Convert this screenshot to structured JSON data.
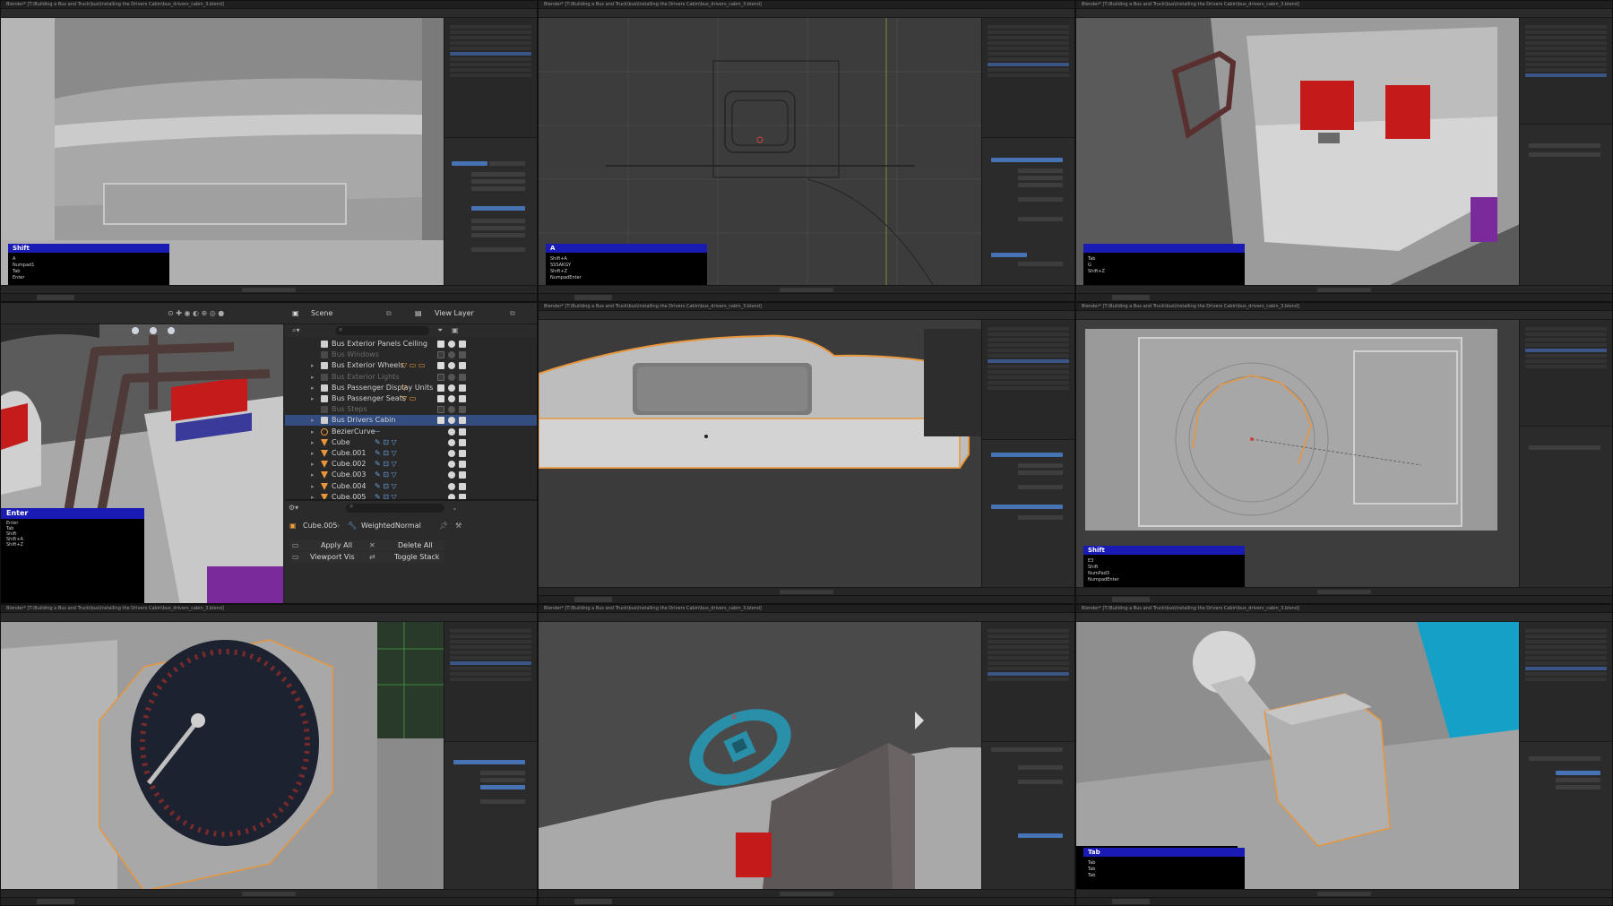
{
  "panels_small": {
    "window_title": "Blender* [T:\\Building a Bus and Truck\\bus\\Installing the Drivers Cabin\\bus_drivers_cabin_3.blend]",
    "p1_keys": {
      "head": "Shift",
      "lines": [
        "A",
        "Numpad1",
        "Tab",
        "Enter"
      ]
    },
    "p2_keys": {
      "head": "A",
      "lines": [
        "Shift+A",
        "SSSAKGY",
        "Shift+Z",
        "NumpadEnter"
      ]
    },
    "p3_keys": {
      "head": "",
      "lines": [
        "Tab",
        "G",
        "Shift+Z"
      ]
    },
    "p6_keys": {
      "head": "Shift",
      "lines": [
        "E3",
        "Shift",
        "NumPad3",
        "NumpadEnter"
      ]
    },
    "p9_keys": {
      "head": "Tab",
      "lines": [
        "Tab",
        "Tab",
        "Tab"
      ]
    }
  },
  "main_panel": {
    "scene_label": "Scene",
    "view_layer_label": "View Layer",
    "outliner_rows": [
      {
        "name": "Bus Exterior Panels Ceiling",
        "dim": false,
        "sel": false,
        "mods": "",
        "icon": "collection",
        "arrow": ""
      },
      {
        "name": "Bus Windows",
        "dim": true,
        "sel": false,
        "mods": "",
        "icon": "collection",
        "arrow": ""
      },
      {
        "name": "Bus Exterior Wheels",
        "dim": false,
        "sel": false,
        "mods": "▽ ▭ ▭",
        "icon": "collection",
        "arrow": "▸"
      },
      {
        "name": "Bus Exterior Lights",
        "dim": true,
        "sel": false,
        "mods": "",
        "icon": "collection",
        "arrow": "▸"
      },
      {
        "name": "Bus Passenger Display Units",
        "dim": false,
        "sel": false,
        "mods": "▽",
        "icon": "collection",
        "arrow": "▸"
      },
      {
        "name": "Bus Passenger Seats",
        "dim": false,
        "sel": false,
        "mods": "▽ ▭",
        "icon": "collection",
        "arrow": "▸"
      },
      {
        "name": "Bus Steps",
        "dim": true,
        "sel": false,
        "mods": "",
        "icon": "collection",
        "arrow": ""
      },
      {
        "name": "Bus Drivers Cabin",
        "dim": false,
        "sel": true,
        "mods": "",
        "icon": "collection",
        "arrow": "▸"
      },
      {
        "name": "BezierCurve",
        "dim": false,
        "sel": false,
        "mods": "~",
        "icon": "curve",
        "arrow": "▸"
      },
      {
        "name": "Cube",
        "dim": false,
        "sel": false,
        "mods": "✎ ⊡ ▽",
        "icon": "mesh",
        "arrow": "▸"
      },
      {
        "name": "Cube.001",
        "dim": false,
        "sel": false,
        "mods": "✎ ⊡ ▽",
        "icon": "mesh",
        "arrow": "▸"
      },
      {
        "name": "Cube.002",
        "dim": false,
        "sel": false,
        "mods": "✎ ⊡ ▽",
        "icon": "mesh",
        "arrow": "▸"
      },
      {
        "name": "Cube.003",
        "dim": false,
        "sel": false,
        "mods": "✎ ⊡ ▽",
        "icon": "mesh",
        "arrow": "▸"
      },
      {
        "name": "Cube.004",
        "dim": false,
        "sel": false,
        "mods": "✎ ⊡ ▽",
        "icon": "mesh",
        "arrow": "▸"
      },
      {
        "name": "Cube.005",
        "dim": false,
        "sel": false,
        "mods": "✎ ⊡ ▽",
        "icon": "mesh",
        "arrow": "▸"
      }
    ],
    "breadcrumb_object": "Cube.005",
    "breadcrumb_modifier": "WeightedNormal",
    "apply_all": "Apply All",
    "delete_all": "Delete All",
    "viewport_vis": "Viewport Vis",
    "toggle_stack": "Toggle Stack",
    "key_overlay": {
      "head": "Enter",
      "lines": [
        "Enter",
        "Tab",
        "Shift",
        "Shift+A",
        "Shift+Z"
      ]
    }
  },
  "colors": {
    "selection": "#334d80",
    "accent_orange": "#e8963c",
    "key_overlay_bar": "#1a1ab5"
  }
}
